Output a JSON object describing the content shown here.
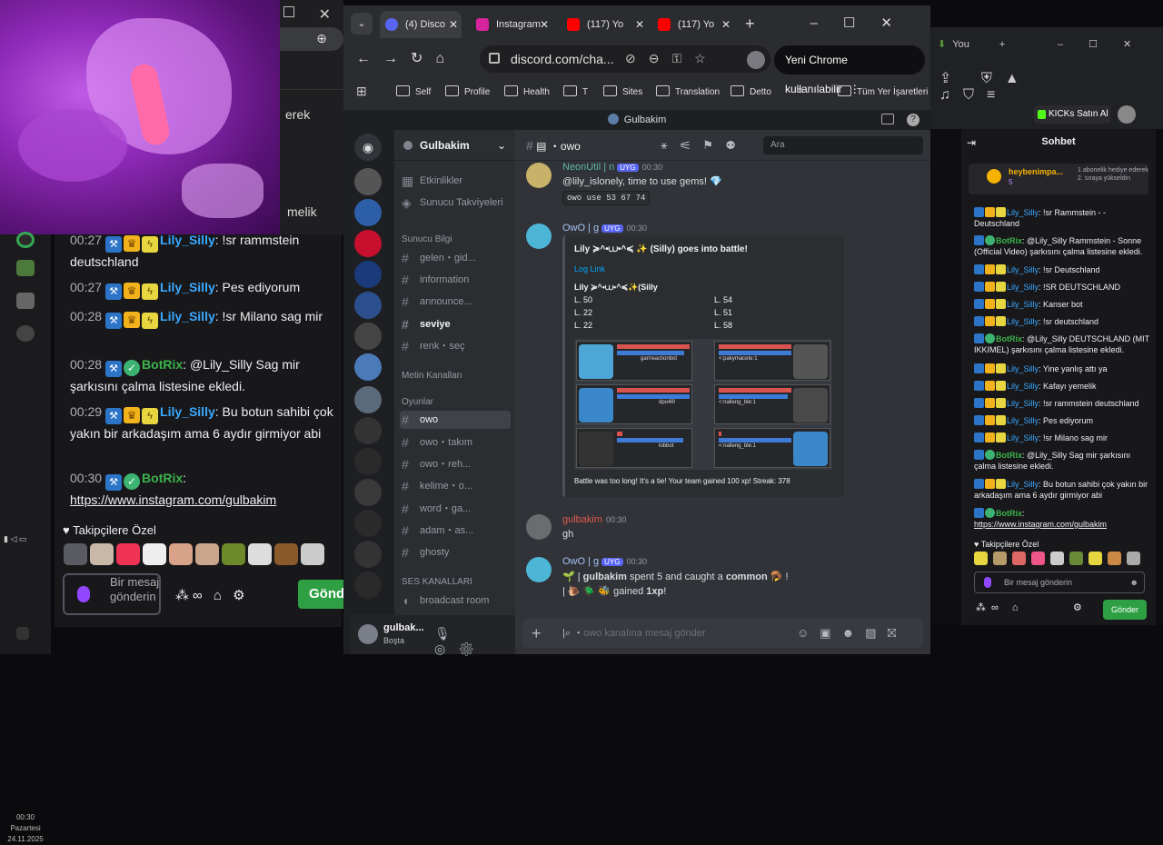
{
  "left_browser": {
    "zoom_icon": "zoom-in-icon",
    "partial_text_1": "erek",
    "partial_text_2": "melik"
  },
  "twitch_chat": {
    "messages": [
      {
        "time": "00:27",
        "user": "Lily_Silly",
        "text": ": !sr rammstein deutschland"
      },
      {
        "time": "00:27",
        "user": "Lily_Silly",
        "text": ": Pes ediyorum"
      },
      {
        "time": "00:28",
        "user": "Lily_Silly",
        "text": ": !sr Milano sag mir"
      },
      {
        "time": "00:28",
        "user": "BotRix",
        "text": ": @Lily_Silly Sag mir şarkısını çalma listesine ekledi."
      },
      {
        "time": "00:29",
        "user": "Lily_Silly",
        "text": ": Bu botun sahibi çok yakın bir arkadaşım ama 6 aydır girmiyor abi"
      },
      {
        "time": "00:30",
        "user": "BotRix",
        "text": ":",
        "link": "https://www.instagram.com/gulbakim"
      }
    ],
    "followers_label": "Takipçilere Özel",
    "input_placeholder": "Bir mesaj gönderin",
    "send_label": "Gönd"
  },
  "taskbar": {
    "time": "00:30",
    "day": "Pazartesi",
    "date": "24.11.2025"
  },
  "chrome": {
    "tabs": [
      {
        "label": "(4) Disco",
        "favicon": "discord-icon"
      },
      {
        "label": "Instagram",
        "favicon": "instagram-icon"
      },
      {
        "label": "(117) Yo",
        "favicon": "youtube-icon"
      },
      {
        "label": "(117) Yo",
        "favicon": "youtube-icon"
      }
    ],
    "url": "discord.com/cha...",
    "promo_button": "Yeni Chrome kullanılabilir",
    "bookmarks": [
      "Self",
      "Profile",
      "Health",
      "T",
      "Sites",
      "Translation",
      "Detto",
      "Tüm Yer İşaretleri"
    ]
  },
  "discord": {
    "window_title": "Gulbakim",
    "server_name": "Gulbakim",
    "nav": [
      "Etkinlikler",
      "Sunucu Takviyeleri"
    ],
    "categories": {
      "info": "Sunucu Bilgi",
      "text": "Metin Kanalları",
      "games": "Oyunlar",
      "voice": "SES KANALLARI"
    },
    "channels_info": [
      "gelen・gid...",
      "information",
      "announce...",
      "seviye",
      "renk・seç"
    ],
    "channels_games": [
      "owo",
      "owo・takım",
      "owo・reh...",
      "kelime・o...",
      "word・ga...",
      "adam・as...",
      "ghosty",
      "broadcast room"
    ],
    "user": {
      "name": "gulbak...",
      "status": "Boşta"
    },
    "channel_header": "owo",
    "search_placeholder": "Ara",
    "messages": {
      "m1": {
        "name": "NeonUtil | n",
        "badge": "UYG",
        "time": "00:30",
        "text": "@lily_islonely, time to use gems! 💎",
        "code": "owo use 53 67 74"
      },
      "m2": {
        "name": "OwO | g",
        "badge": "UYG",
        "time": "00:30",
        "embed_title": "Lily ≽^•⩊•^≼ ✨ (Silly) goes into battle!",
        "embed_link": "Log Link",
        "team_left_name": "Lily ≽^•⩊•^≼✨(Silly",
        "team_left": [
          "L. 50",
          "L. 22",
          "L. 22"
        ],
        "team_right": [
          "L. 54",
          "L. 51",
          "L. 58"
        ],
        "battle_labels": [
          "1806/1806",
          "294/305",
          "gar/reactionbot",
          "1904/1904",
          "320/320",
          "<:pakymacete:1",
          "1812/1812",
          "344/344",
          "dpo4l0",
          "1928/1928",
          "289/302",
          "<:nalleng_ble:1",
          "80/1116",
          "498/544",
          "lobbot",
          "46/1420",
          "1/1",
          "<:nalleng_ble:1"
        ],
        "footer": "Battle was too long! It's a tie! Your team gained 100 xp! Streak: 378"
      },
      "m3": {
        "name": "gulbakim",
        "time": "00:30",
        "text": "gh"
      },
      "m4": {
        "name": "OwO | g",
        "badge": "UYG",
        "time": "00:30",
        "line1_user": "gulbakim",
        "line1": " spent 5 and caught a ",
        "line1_bold": "common",
        "line2": " gained ",
        "line2_bold": "1xp",
        "line2_end": "!"
      }
    },
    "input_placeholder": "owo kanalına mesaj gönder"
  },
  "right_panel": {
    "tab_label": "You",
    "kicks_label": "KICKs Satın Al",
    "chat_title": "Sohbet",
    "pinned": {
      "name": "heybenimpa...",
      "count": "5",
      "text": "1 abonelik hediye ederek 2. sıraya yükseldin"
    },
    "messages": [
      {
        "user": "Lily_Silly",
        "text": ": !sr Rammstein - - Deutschland"
      },
      {
        "user": "BotRix",
        "text": ": @Lily_Silly Rammstein - Sonne (Official Video) şarkısını çalma listesine ekledi."
      },
      {
        "user": "Lily_Silly",
        "text": ": !sr Deutschland"
      },
      {
        "user": "Lily_Silly",
        "text": ": !SR DEUTSCHLAND"
      },
      {
        "user": "Lily_Silly",
        "text": ": Kanser bot"
      },
      {
        "user": "Lily_Silly",
        "text": ": !sr deutschland"
      },
      {
        "user": "BotRix",
        "text": ": @Lily_Silly DEUTSCHLAND (MIT IKKIMEL) şarkısını çalma listesine ekledi."
      },
      {
        "user": "Lily_Silly",
        "text": ": Yine yanlış attı ya"
      },
      {
        "user": "Lily_Silly",
        "text": ": Kafayı yemelik"
      },
      {
        "user": "Lily_Silly",
        "text": ": !sr rammstein deutschland"
      },
      {
        "user": "Lily_Silly",
        "text": ": Pes ediyorum"
      },
      {
        "user": "Lily_Silly",
        "text": ": !sr Milano sag mir"
      },
      {
        "user": "BotRix",
        "text": ": @Lily_Silly Sag mir şarkısını çalma listesine ekledi."
      },
      {
        "user": "Lily_Silly",
        "text": ": Bu botun sahibi çok yakın bir arkadaşım ama 6 aydır girmiyor abi"
      },
      {
        "user": "BotRix",
        "text": ":",
        "link": "https://www.instagram.com/gulbakim"
      }
    ],
    "followers_label": "Takipçilere Özel",
    "input_placeholder": "Bir mesaj gönderin",
    "send_label": "Gönder"
  }
}
